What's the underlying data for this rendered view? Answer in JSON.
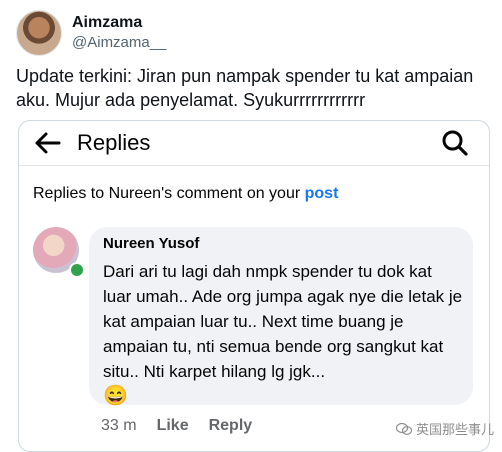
{
  "tweet": {
    "display_name": "Aimzama",
    "handle": "@Aimzama__",
    "text": "Update terkini: Jiran pun nampak spender tu kat ampaian aku. Mujur ada penyelamat. Syukurrrrrrrrrrrr"
  },
  "fb": {
    "header_title": "Replies",
    "replies_to_prefix": "Replies to Nureen's comment on your ",
    "replies_to_link": "post",
    "comment": {
      "author": "Nureen Yusof",
      "text": "Dari ari tu lagi dah nmpk spender tu dok kat luar umah.. Ade org jumpa agak nye die letak je kat ampaian luar tu.. Next time buang je ampaian tu, nti semua bende org sangkut kat situ.. Nti karpet hilang lg jgk...",
      "emoji": "😄",
      "time": "33 m",
      "like_label": "Like",
      "reply_label": "Reply"
    }
  },
  "watermark": "英国那些事儿",
  "colors": {
    "link": "#1877f2",
    "online": "#31a24c",
    "bubble": "#f0f2f5"
  },
  "icons": [
    "back-arrow-icon",
    "search-icon",
    "wechat-icon"
  ]
}
